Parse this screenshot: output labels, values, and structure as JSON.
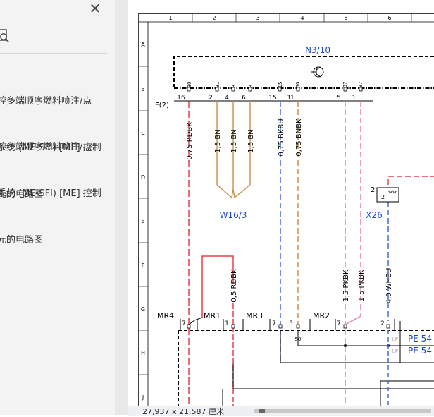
{
  "sidebar": {
    "close_label": "✕",
    "search_icon": "search-document-icon",
    "results": [
      {
        "lines": [
          "控多端顺序燃料喷注/点",
          "系统 (ME-SFI) [ME] 控制",
          "元的电路图"
        ]
      },
      {
        "lines": [
          "控多端顺序燃料喷注/点",
          "系统 (ME-SFI) [ME] 控制",
          "元的电路图"
        ]
      }
    ],
    "collapse_icon": "collapse-left-triangle-icon"
  },
  "diagram": {
    "col_labels": [
      "1",
      "2",
      "3",
      "4",
      "5",
      "6"
    ],
    "row_labels": [
      "A",
      "B",
      "C",
      "D",
      "E",
      "F",
      "G",
      "H",
      "J"
    ],
    "component_title": "N3/10",
    "connector_label": "F(2)",
    "pins_top": [
      "30",
      "31",
      "31",
      "31",
      "15",
      "50",
      "87",
      "87"
    ],
    "pins_bottom": [
      "16",
      "2",
      "4",
      "6",
      "15",
      "31",
      "5",
      "3"
    ],
    "wires": [
      "0,75 RDBK",
      "1,5 BN",
      "1,5 BN",
      "1,5 BN",
      "0,75 BKBU",
      "0,75 BNBK",
      "0,5 RDBK",
      "1,5 PKBK",
      "1,5 PKBK",
      "4,0 WHBU"
    ],
    "ground_label": "W16/3",
    "x26_label": "X26",
    "x26_pin_outer": "2",
    "x26_pin_inner": "2",
    "mr_labels": [
      "MR4",
      "MR1",
      "MR3",
      "MR2"
    ],
    "mr_pins": [
      "7",
      "1",
      "7",
      "5",
      "7",
      "2"
    ],
    "node_50": "50",
    "pe_refs": [
      "PE 54",
      "PE 54"
    ],
    "wire_colors": {
      "red": "#e8404a",
      "brown": "#c8914e",
      "blue": "#4a6cd8",
      "pink": "#e87eb0",
      "label_blue": "#1a44d0"
    }
  },
  "status": {
    "size_text": "27,937 x 21,587 厘米"
  }
}
